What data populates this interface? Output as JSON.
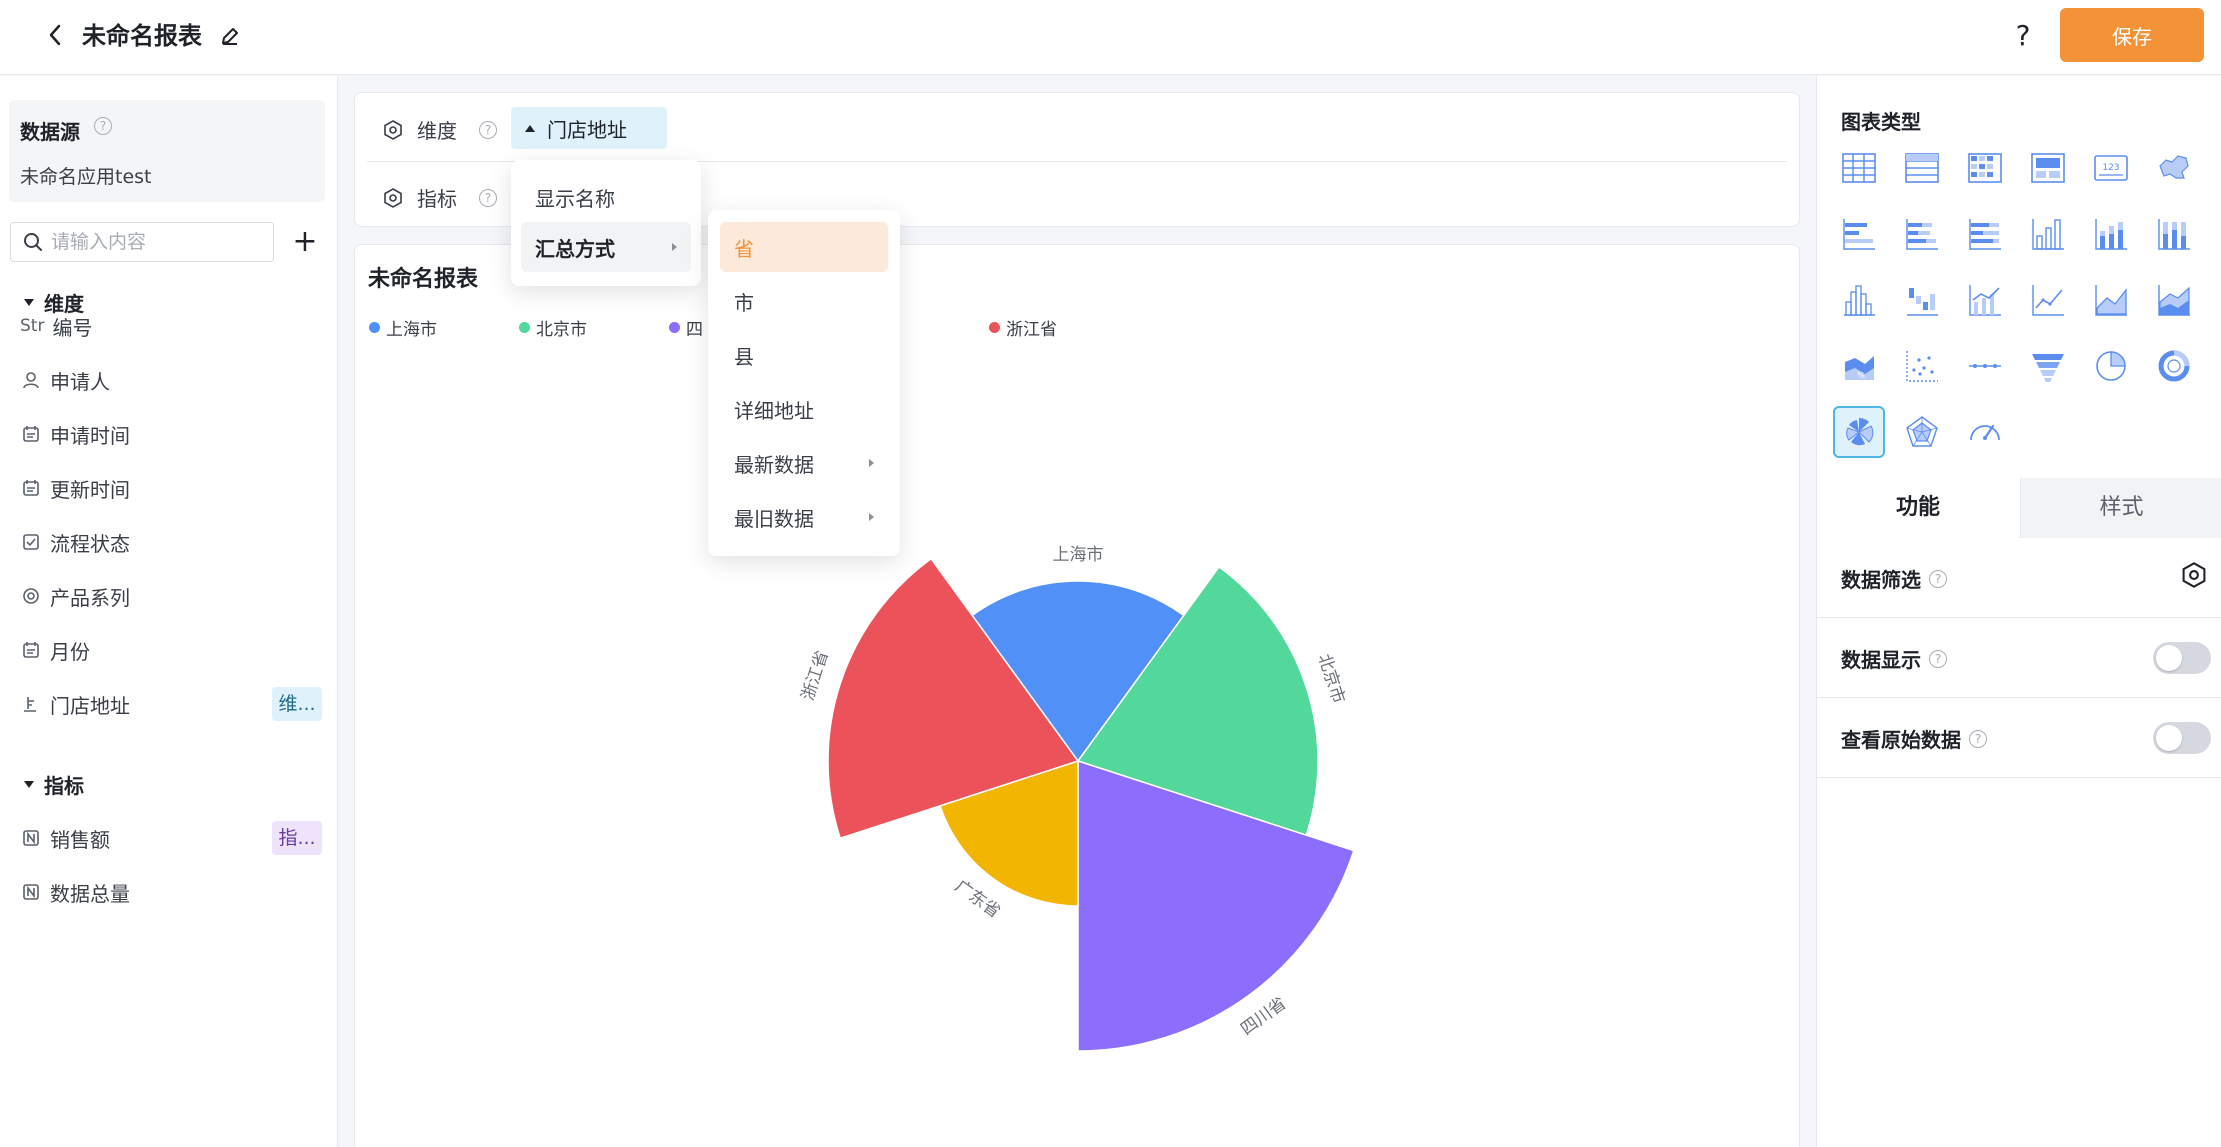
{
  "header": {
    "title": "未命名报表",
    "save_label": "保存",
    "help_label": "?"
  },
  "sidebar": {
    "datasource_title": "数据源",
    "datasource_name": "未命名应用test",
    "search_placeholder": "请输入内容",
    "add_label": "+",
    "dimension_group": "维度",
    "dimension_fields": [
      {
        "icon": "Str",
        "label": "编号"
      },
      {
        "icon": "user-icon",
        "label": "申请人"
      },
      {
        "icon": "calendar-icon",
        "label": "申请时间"
      },
      {
        "icon": "calendar-icon",
        "label": "更新时间"
      },
      {
        "icon": "checkbox-icon",
        "label": "流程状态"
      },
      {
        "icon": "radio-icon",
        "label": "产品系列"
      },
      {
        "icon": "calendar-icon",
        "label": "月份"
      },
      {
        "icon": "location-icon",
        "label": "门店地址",
        "badge": "维..."
      }
    ],
    "indicator_group": "指标",
    "indicator_fields": [
      {
        "icon": "number-icon",
        "label": "销售额",
        "badge": "指..."
      },
      {
        "icon": "number-icon",
        "label": "数据总量"
      }
    ]
  },
  "config": {
    "dimension_label": "维度",
    "indicator_label": "指标",
    "dimension_chip": "门店地址"
  },
  "menu": {
    "items": [
      "显示名称",
      "汇总方式"
    ],
    "submenu": [
      "省",
      "市",
      "县",
      "详细地址",
      "最新数据",
      "最旧数据"
    ]
  },
  "chart": {
    "title": "未命名报表",
    "legend_visible": [
      "上海市",
      "北京市",
      "四",
      "浙江省"
    ]
  },
  "chart_data": {
    "type": "pie",
    "subtype": "rose",
    "title": "未命名报表",
    "legend_position": "top-left",
    "categories": [
      "上海市",
      "北京市",
      "四川省",
      "广东省",
      "浙江省"
    ],
    "values": [
      180,
      240,
      290,
      145,
      250
    ],
    "colors": [
      "#5090f7",
      "#52d89a",
      "#8d6dfb",
      "#f1b502",
      "#ec525a"
    ]
  },
  "right_panel": {
    "chart_type_title": "图表类型",
    "tabs": [
      "功能",
      "样式"
    ],
    "settings": [
      "数据筛选",
      "数据显示",
      "查看原始数据"
    ],
    "chart_types": [
      "table-icon",
      "list-icon",
      "pivot-icon",
      "dashboard-card-icon",
      "number-card-icon",
      "map-icon",
      "bar-horizontal-icon",
      "bar-horizontal-stacked-icon",
      "bar-horizontal-percent-icon",
      "column-icon",
      "column-stacked-icon",
      "column-percent-icon",
      "histogram-icon",
      "waterfall-icon",
      "combo-icon",
      "line-icon",
      "area-icon",
      "area-stacked-icon",
      "area-percent-icon",
      "scatter-icon",
      "dot-line-icon",
      "funnel-icon",
      "pie-icon",
      "donut-icon",
      "rose-icon",
      "radar-icon",
      "gauge-icon"
    ],
    "accent": "#4fb6e8"
  }
}
